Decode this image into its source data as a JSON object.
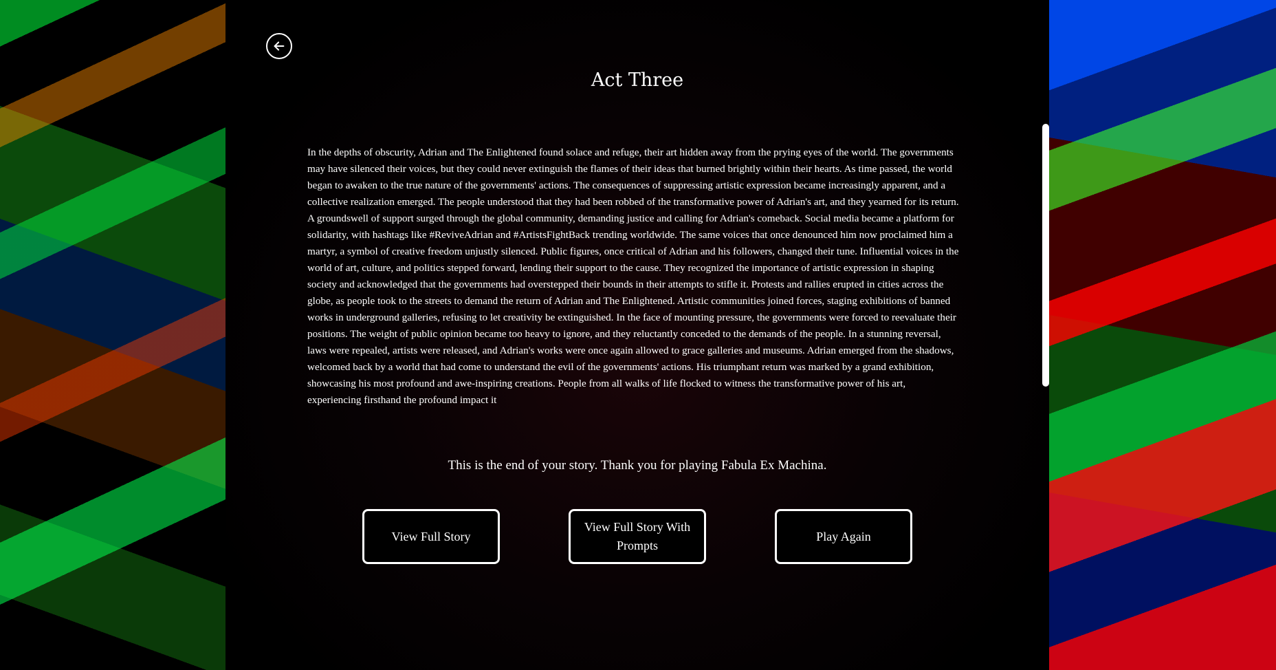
{
  "title": "Act Three",
  "story": "In the depths of obscurity, Adrian and The Enlightened found solace and refuge, their art hidden away from the prying eyes of the world. The governments may have silenced their voices, but they could never extinguish the flames of their ideas that burned brightly within their hearts. As time passed, the world began to awaken to the true nature of the governments' actions. The consequences of suppressing artistic expression became increasingly apparent, and a collective realization emerged. The people understood that they had been robbed of the transformative power of Adrian's art, and they yearned for its return. A groundswell of support surged through the global community, demanding justice and calling for Adrian's comeback. Social media became a platform for solidarity, with hashtags like #ReviveAdrian and #ArtistsFightBack trending worldwide. The same voices that once denounced him now proclaimed him a martyr, a symbol of creative freedom unjustly silenced. Public figures, once critical of Adrian and his followers, changed their tune. Influential voices in the world of art, culture, and politics stepped forward, lending their support to the cause. They recognized the importance of artistic expression in shaping society and acknowledged that the governments had overstepped their bounds in their attempts to stifle it. Protests and rallies erupted in cities across the globe, as people took to the streets to demand the return of Adrian and The Enlightened. Artistic communities joined forces, staging exhibitions of banned works in underground galleries, refusing to let creativity be extinguished. In the face of mounting pressure, the governments were forced to reevaluate their positions. The weight of public opinion became too heavy to ignore, and they reluctantly conceded to the demands of the people. In a stunning reversal, laws were repealed, artists were released, and Adrian's works were once again allowed to grace galleries and museums. Adrian emerged from the shadows, welcomed back by a world that had come to understand the evil of the governments' actions. His triumphant return was marked by a grand exhibition, showcasing his most profound and awe-inspiring creations. People from all walks of life flocked to witness the transformative power of his art, experiencing firsthand the profound impact it",
  "end_message": "This is the end of your story. Thank you for playing Fabula Ex Machina.",
  "buttons": {
    "view_full_story": "View Full Story",
    "view_full_story_prompts": "View Full Story With Prompts",
    "play_again": "Play Again"
  },
  "icons": {
    "back": "arrow-left-circle-icon"
  },
  "colors": {
    "panel_bg": "#000000",
    "text": "#ffffff"
  }
}
